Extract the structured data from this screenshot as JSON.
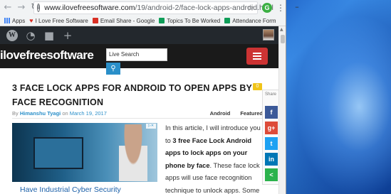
{
  "browser": {
    "url_host": "www.ilovefreesoftware.com",
    "url_path": "/19/android-2/face-lock-apps-android.html",
    "extension_letter": "G",
    "bookmarks": [
      {
        "label": "Apps",
        "icon": "apps-grid-icon"
      },
      {
        "label": "I Love Free Software",
        "icon": "heart-icon"
      },
      {
        "label": "Email Share - Google",
        "icon": "mail-icon"
      },
      {
        "label": "Topics To Be Worked",
        "icon": "sheet-icon"
      },
      {
        "label": "Attendance Form",
        "icon": "form-icon"
      }
    ]
  },
  "site": {
    "logo": "ilovefreesoftware",
    "search_placeholder": "Live Search"
  },
  "post": {
    "title": "3 FACE LOCK APPS FOR ANDROID TO OPEN APPS BY FACE RECOGNITION",
    "comment_count": "0",
    "by": "By",
    "author": "Himanshu Tyagi",
    "on": "on",
    "date": "March 19, 2017",
    "categories": [
      "Android",
      "Featured"
    ],
    "ad_caption": "Have Industrial Cyber Security",
    "body_1": "In this article, I will introduce you to ",
    "body_bold": "3 free Face Lock Android apps to lock apps on your phone by face",
    "body_2": ". These face lock apps will use face recognition technique to unlock apps. Some"
  },
  "share": {
    "label": "Share",
    "buttons": [
      "f",
      "g+",
      "t",
      "in",
      "<"
    ]
  }
}
